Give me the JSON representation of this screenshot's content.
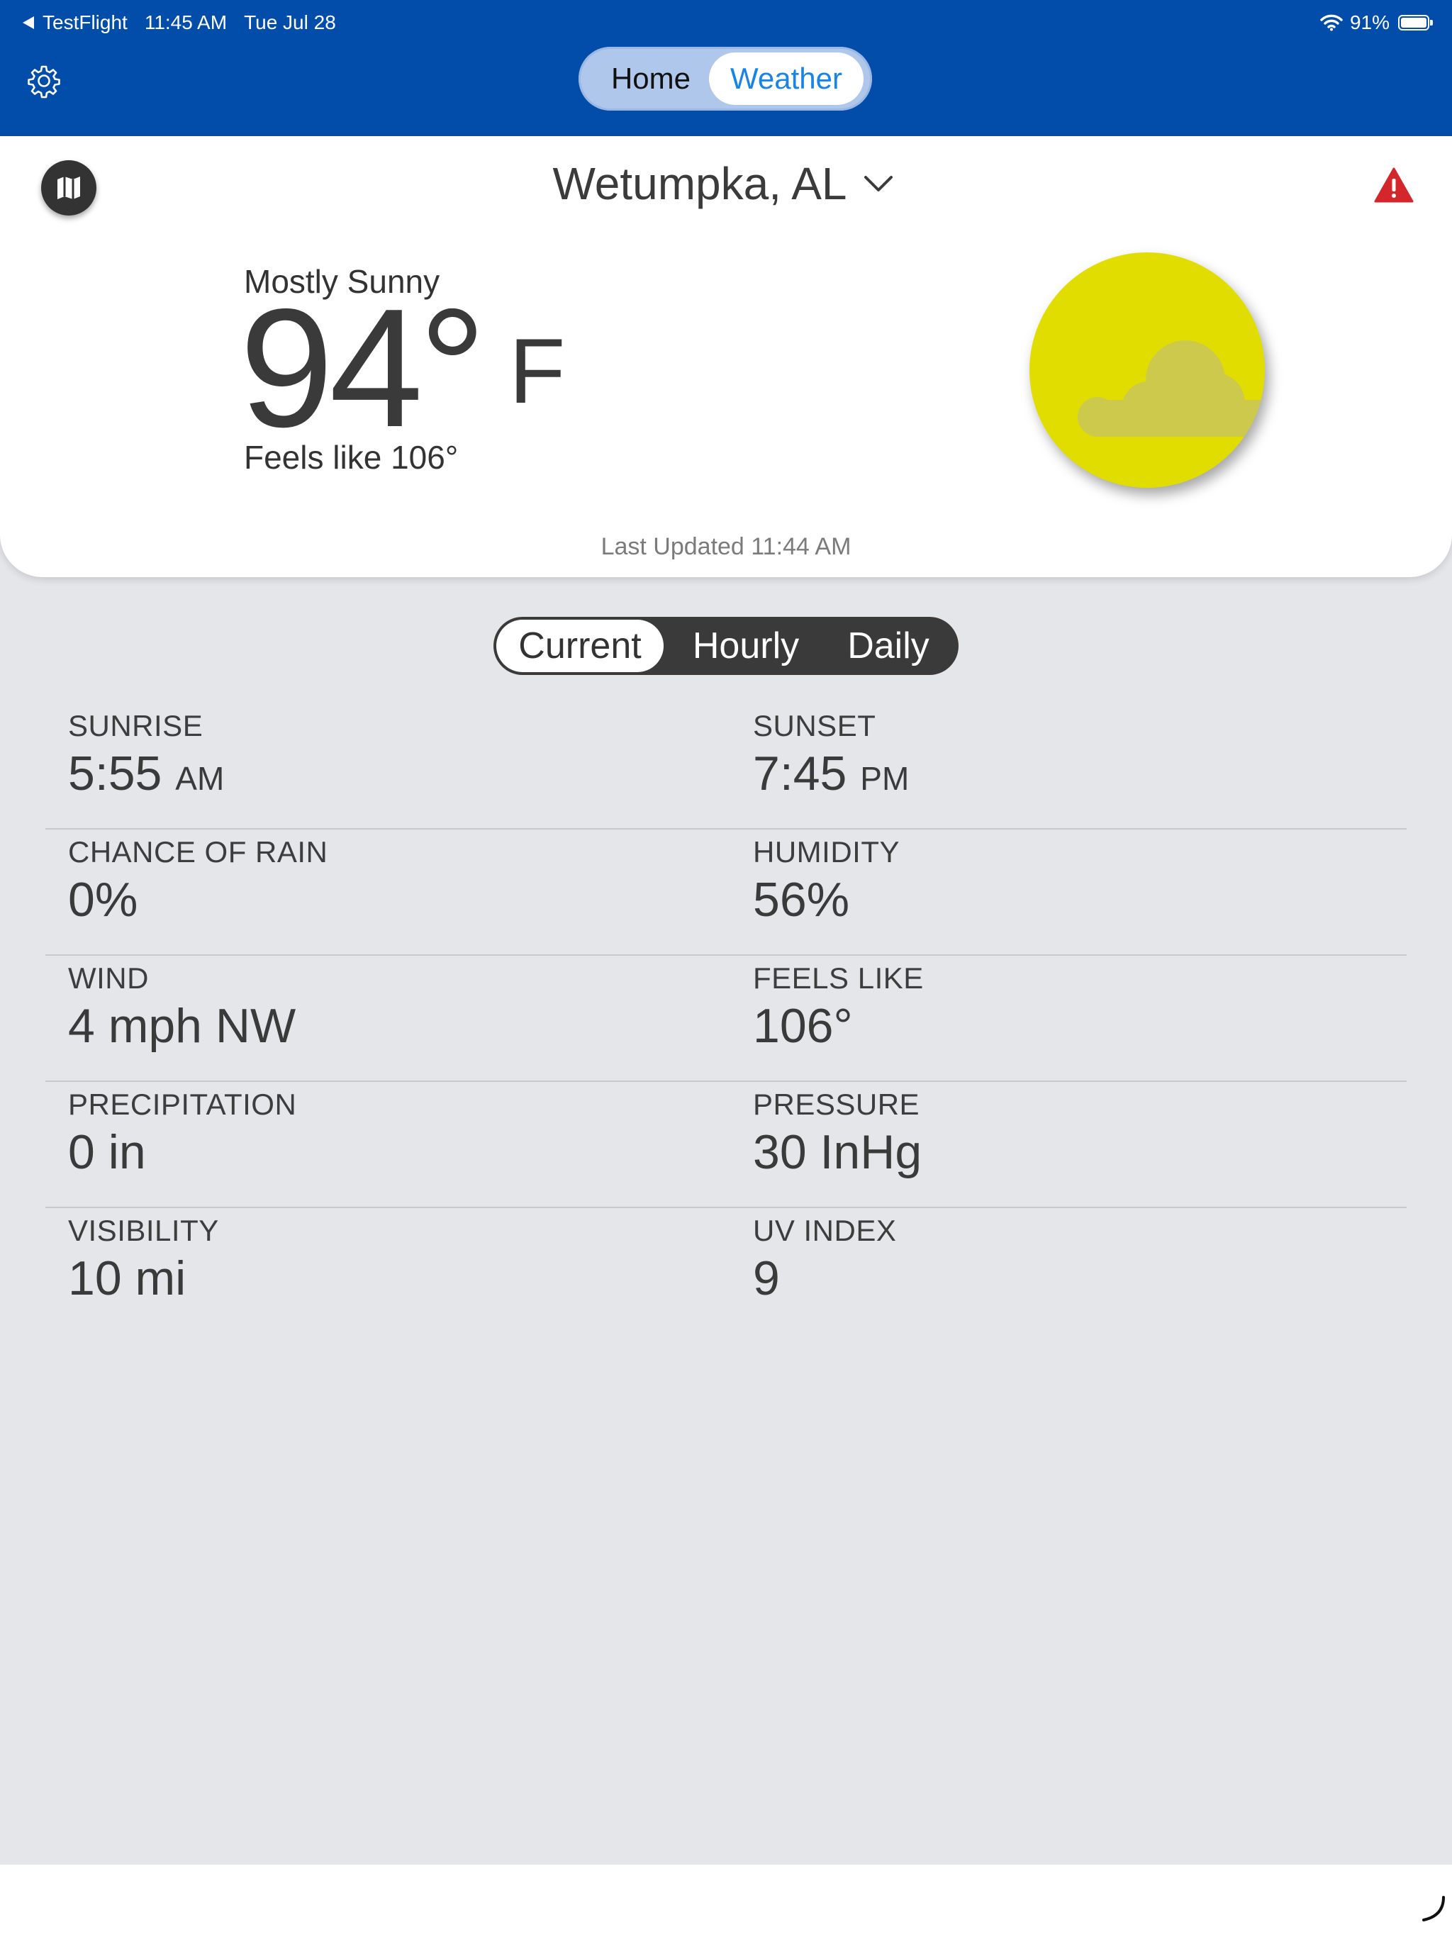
{
  "status_bar": {
    "back_app": "TestFlight",
    "time": "11:45 AM",
    "date": "Tue Jul 28",
    "battery": "91%"
  },
  "nav": {
    "tabs": [
      {
        "label": "Home"
      },
      {
        "label": "Weather"
      }
    ],
    "selected": "Weather"
  },
  "header": {
    "location": "Wetumpka, AL"
  },
  "current": {
    "condition": "Mostly Sunny",
    "temperature": "94°",
    "unit": "F",
    "feels_like": "Feels like 106°",
    "last_updated": "Last Updated 11:44 AM"
  },
  "segments": {
    "items": [
      {
        "label": "Current"
      },
      {
        "label": "Hourly"
      },
      {
        "label": "Daily"
      }
    ],
    "selected": "Current"
  },
  "stats": {
    "sunrise": {
      "label": "SUNRISE",
      "value": "5:55",
      "suffix": "AM"
    },
    "sunset": {
      "label": "SUNSET",
      "value": "7:45",
      "suffix": "PM"
    },
    "rain": {
      "label": "CHANCE OF RAIN",
      "value": "0%"
    },
    "humidity": {
      "label": "HUMIDITY",
      "value": "56%"
    },
    "wind": {
      "label": "WIND",
      "value": "4 mph NW"
    },
    "feels": {
      "label": "FEELS LIKE",
      "value": "106°"
    },
    "precip": {
      "label": "PRECIPITATION",
      "value": "0 in"
    },
    "pressure": {
      "label": "PRESSURE",
      "value": "30 InHg"
    },
    "visibility": {
      "label": "VISIBILITY",
      "value": "10 mi"
    },
    "uv": {
      "label": "UV INDEX",
      "value": "9"
    }
  },
  "colors": {
    "header_blue": "#024da9",
    "accent_blue": "#1a83e8",
    "sun_yellow": "#e1dd00",
    "alert_red": "#d3272b"
  },
  "icons": [
    "gear-icon",
    "map-icon",
    "chevron-down-icon",
    "alert-icon",
    "partly-cloudy-icon",
    "wifi-icon",
    "battery-icon"
  ]
}
